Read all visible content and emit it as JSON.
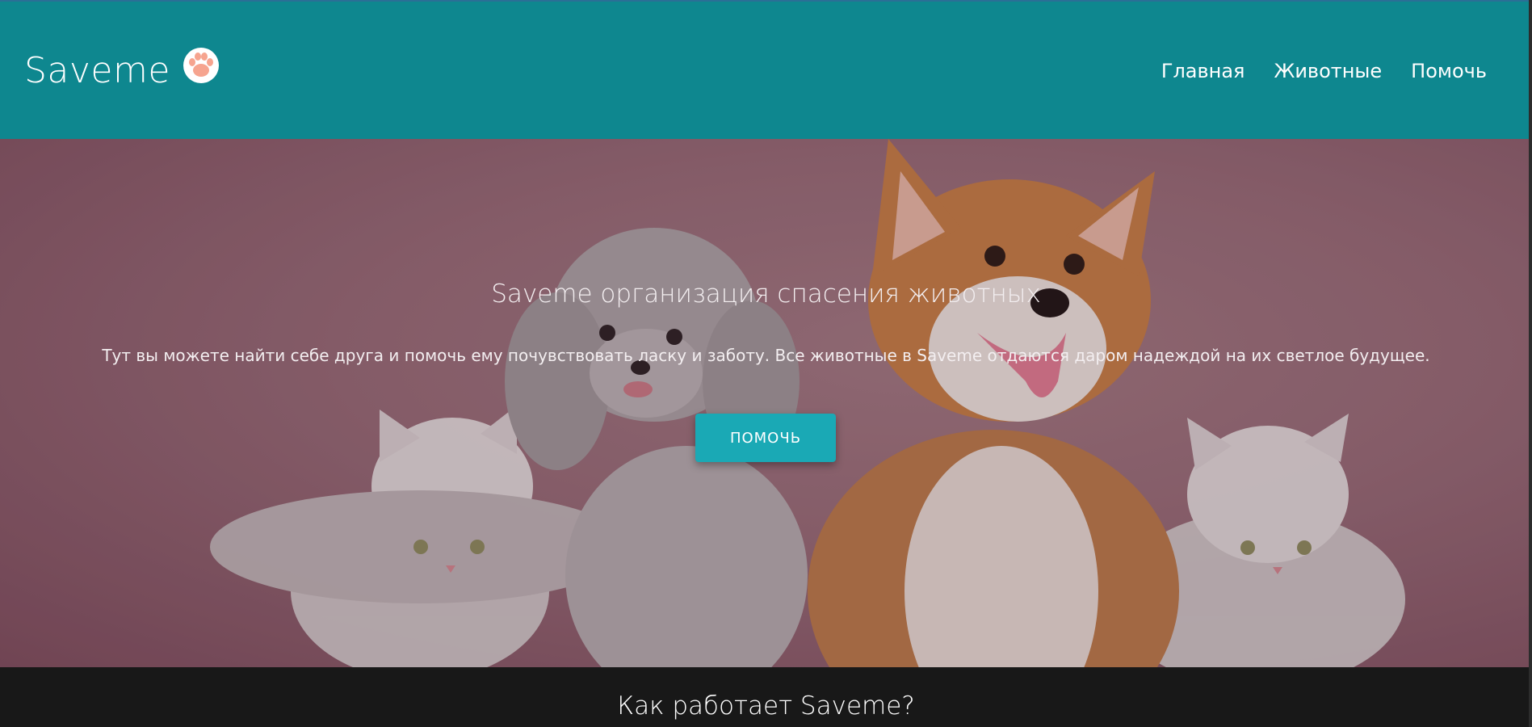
{
  "header": {
    "logo_text": "Saveme",
    "logo_icon": "paw-icon",
    "nav": [
      {
        "label": "Главная"
      },
      {
        "label": "Животные"
      },
      {
        "label": "Помочь"
      }
    ],
    "background": "#0e878f"
  },
  "hero": {
    "title": "Saveme организация спасения животных",
    "subtitle": "Тут вы можете найти себе друга и помочь ему почувствовать ласку и заботу. Все животные в Saveme отдаются даром надеждой на их светлое будущее.",
    "button_label": "ПОМОЧЬ",
    "button_color": "#1aa9b5",
    "image_subject": "two cats, a poodle and a corgi on pink background"
  },
  "how_it_works": {
    "title": "Как работает Saveme?"
  }
}
